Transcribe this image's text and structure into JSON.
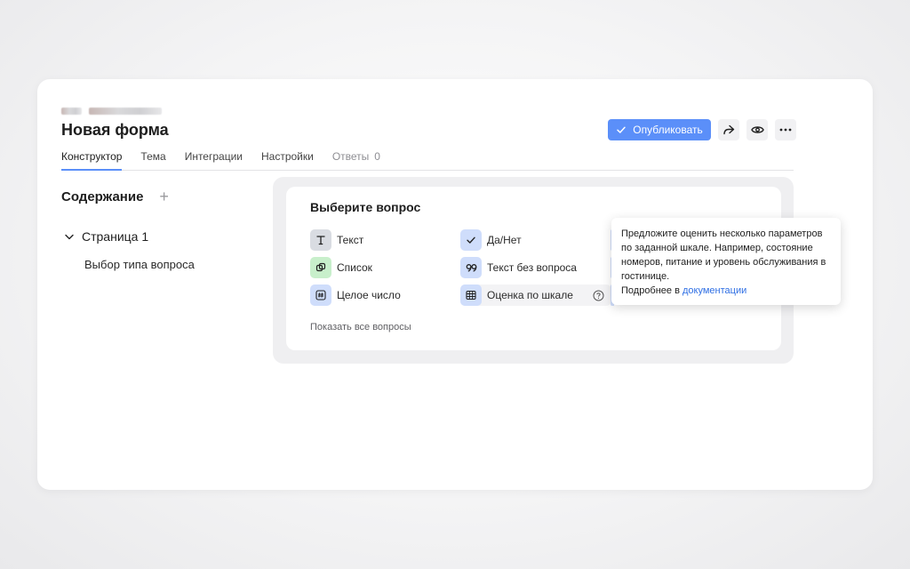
{
  "form": {
    "title": "Новая форма"
  },
  "toolbar": {
    "publish_label": "Опубликовать",
    "share_icon": "share-icon",
    "preview_icon": "eye-icon",
    "more_icon": "more-dots-icon"
  },
  "tabs": [
    {
      "label": "Конструктор",
      "active": true
    },
    {
      "label": "Тема"
    },
    {
      "label": "Интеграции"
    },
    {
      "label": "Настройки"
    },
    {
      "label": "Ответы",
      "count": "0"
    }
  ],
  "sidebar": {
    "heading": "Содержание",
    "page_label": "Страница 1",
    "item_label": "Выбор типа вопроса"
  },
  "picker": {
    "title": "Выберите вопрос",
    "questions": [
      {
        "label": "Текст",
        "icon": "text-t-icon"
      },
      {
        "label": "Список",
        "icon": "list-copy-icon"
      },
      {
        "label": "Целое число",
        "icon": "hash-icon"
      },
      {
        "label": "Да/Нет",
        "icon": "check-icon"
      },
      {
        "label": "Текст без вопроса",
        "icon": "quote-icon"
      },
      {
        "label": "Оценка по шкале",
        "icon": "grid-table-icon"
      }
    ],
    "show_all": "Показать все вопросы"
  },
  "tooltip": {
    "text": "Предложите оценить несколько параметров по заданной шкале. Например, состояние номеров, питание и уровень обслуживания в гостинице.",
    "more_prefix": "Подробнее в ",
    "link_text": "документации"
  },
  "colors": {
    "accent": "#5b8ff9",
    "link": "#2f6fe4",
    "green_icon_bg": "#c8efcb",
    "blue_icon_bg": "#cfddfb"
  }
}
